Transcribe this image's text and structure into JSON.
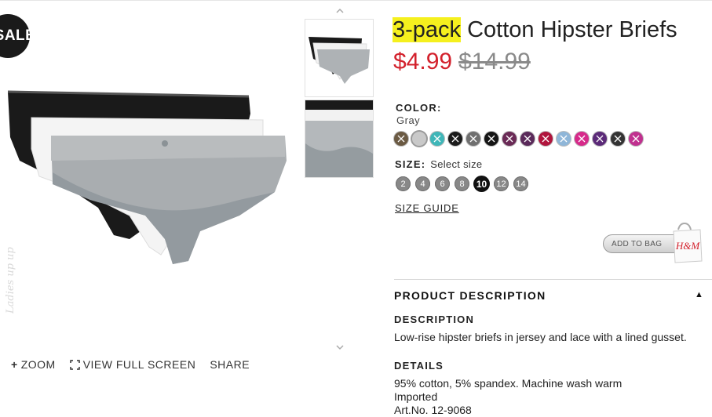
{
  "sale_badge": "SALE",
  "product": {
    "title_highlight": "3-pack",
    "title_rest": " Cotton Hipster Briefs",
    "price_current": "$4.99",
    "price_original": "$14.99"
  },
  "color": {
    "label": "COLOR:",
    "selected": "Gray",
    "swatches": [
      {
        "name": "leopard",
        "color": "#6b5a43"
      },
      {
        "name": "gray",
        "color": "#c9c9c9"
      },
      {
        "name": "turquoise",
        "color": "#3fb6b8"
      },
      {
        "name": "black",
        "color": "#1b1b1b"
      },
      {
        "name": "dark-gray",
        "color": "#707070"
      },
      {
        "name": "black",
        "color": "#151515"
      },
      {
        "name": "plum",
        "color": "#6a2a56"
      },
      {
        "name": "purple",
        "color": "#5a2a5a"
      },
      {
        "name": "red",
        "color": "#b0153d"
      },
      {
        "name": "light-blue",
        "color": "#8fb6d8"
      },
      {
        "name": "pink",
        "color": "#d62a8a"
      },
      {
        "name": "violet",
        "color": "#5b2a78"
      },
      {
        "name": "charcoal",
        "color": "#333333"
      },
      {
        "name": "magenta",
        "color": "#c0308f"
      }
    ]
  },
  "size": {
    "label": "SIZE:",
    "placeholder": "Select size",
    "options": [
      "2",
      "4",
      "6",
      "8",
      "10",
      "12",
      "14"
    ],
    "selected": "10",
    "guide": "SIZE GUIDE"
  },
  "add_to_bag": "ADD TO BAG",
  "bag_logo": "H&M",
  "tools": {
    "zoom": "ZOOM",
    "fullscreen": "VIEW FULL SCREEN",
    "share": "SHARE"
  },
  "watermark": "Ladies up up",
  "product_description": {
    "header": "PRODUCT DESCRIPTION",
    "description_label": "DESCRIPTION",
    "description_text": "Low-rise hipster briefs in jersey and lace with a lined gusset.",
    "details_label": "DETAILS",
    "details": [
      "95% cotton, 5% spandex. Machine wash warm",
      "Imported",
      "Art.No. 12-9068"
    ]
  }
}
